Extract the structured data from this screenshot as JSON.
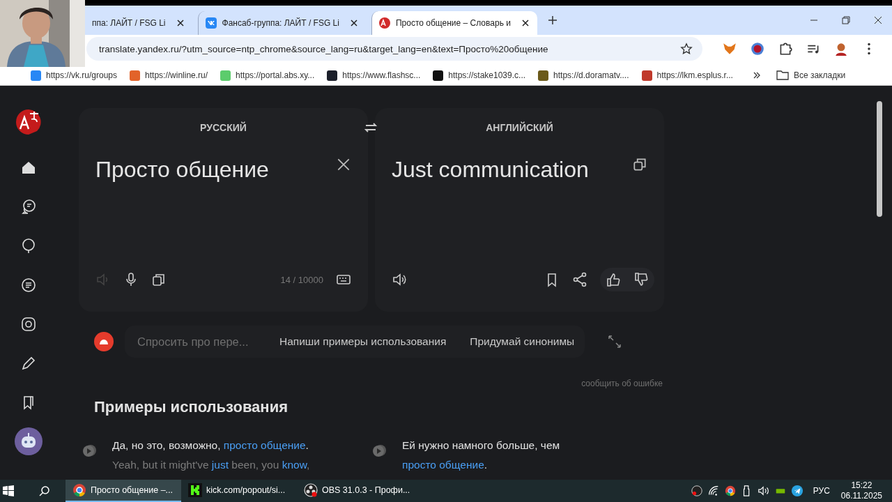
{
  "tabs": [
    {
      "title": "ппа: ЛАЙТ / FSG Li",
      "selected": false
    },
    {
      "title": "Фансаб-группа: ЛАЙТ / FSG Li",
      "selected": false
    },
    {
      "title": "Просто общение – Словарь и",
      "selected": true
    }
  ],
  "address": "translate.yandex.ru/?utm_source=ntp_chrome&source_lang=ru&target_lang=en&text=Просто%20общение",
  "bookmarks": [
    {
      "label": "https://vk.ru/groups",
      "color": "#2787f5"
    },
    {
      "label": "https://winline.ru/",
      "color": "#e2632a"
    },
    {
      "label": "https://portal.abs.xy...",
      "color": "#5ccc6c"
    },
    {
      "label": "https://www.flashsc...",
      "color": "#1b1f2a"
    },
    {
      "label": "https://stake1039.c...",
      "color": "#111111"
    },
    {
      "label": "https://d.doramatv....",
      "color": "#6b5a1a"
    },
    {
      "label": "https://lkm.esplus.r...",
      "color": "#c0392b"
    }
  ],
  "all_bookmarks": "Все закладки",
  "translator": {
    "source_lang": "РУССКИЙ",
    "target_lang": "АНГЛИЙСКИЙ",
    "source_text": "Просто общение",
    "translation": "Just communication",
    "counter": "14 / 10000"
  },
  "assistant": {
    "placeholder": "Спросить про пере...",
    "chips": [
      "Напиши примеры использования",
      "Придумай синонимы"
    ]
  },
  "report_link": "сообщить об ошибке",
  "examples_title": "Примеры использования",
  "examples": [
    {
      "source": [
        {
          "text": "Да, но это, возможно, ",
          "highlight": false
        },
        {
          "text": "просто общение",
          "highlight": true
        },
        {
          "text": ".",
          "highlight": false
        }
      ],
      "translation": [
        {
          "text": "Yeah, but it might've ",
          "highlight": false
        },
        {
          "text": "just",
          "highlight": true
        },
        {
          "text": " been, you ",
          "highlight": false
        },
        {
          "text": "know",
          "highlight": true
        },
        {
          "text": ",",
          "highlight": false
        }
      ]
    },
    {
      "source": [
        {
          "text": "Ей нужно намного больше, чем ",
          "highlight": false
        },
        {
          "text": "просто общение",
          "highlight": true
        },
        {
          "text": ".",
          "highlight": false
        }
      ]
    }
  ],
  "taskbar": {
    "apps": [
      {
        "label": "Просто общение –...",
        "selected": true
      },
      {
        "label": "kick.com/popout/si...",
        "selected": false
      },
      {
        "label": "OBS 31.0.3 - Профи...",
        "selected": false
      }
    ],
    "language": "РУС",
    "time": "15:22",
    "date": "06.11.2025"
  }
}
